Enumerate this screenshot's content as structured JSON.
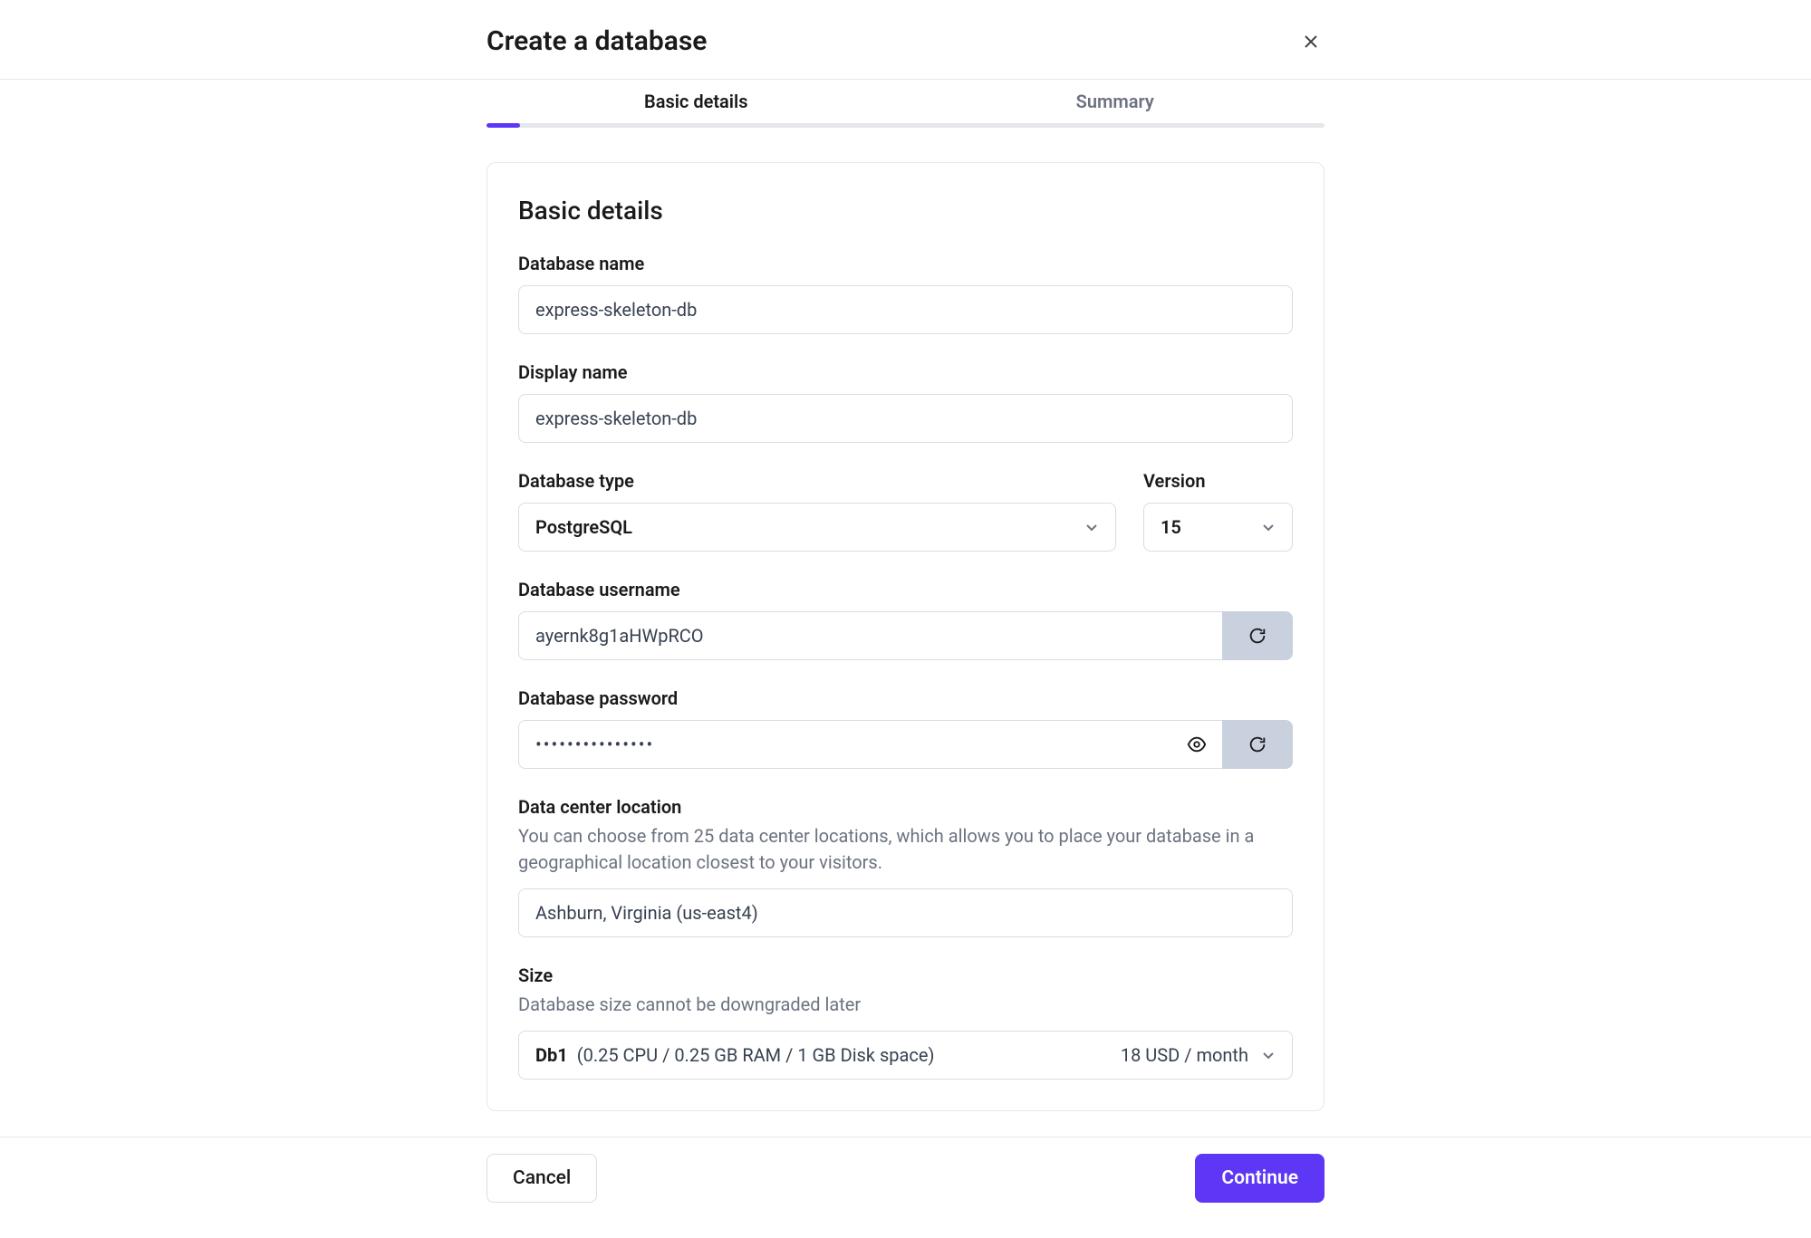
{
  "header": {
    "title": "Create a database"
  },
  "tabs": {
    "basic": "Basic details",
    "summary": "Summary"
  },
  "section": {
    "heading": "Basic details"
  },
  "fields": {
    "db_name": {
      "label": "Database name",
      "value": "express-skeleton-db"
    },
    "display_name": {
      "label": "Display name",
      "value": "express-skeleton-db"
    },
    "db_type": {
      "label": "Database type",
      "value": "PostgreSQL"
    },
    "version": {
      "label": "Version",
      "value": "15"
    },
    "username": {
      "label": "Database username",
      "value": "ayernk8g1aHWpRCO"
    },
    "password": {
      "label": "Database password",
      "value": "•••••••••••••••"
    },
    "location": {
      "label": "Data center location",
      "help": "You can choose from 25 data center locations, which allows you to place your database in a geographical location closest to your visitors.",
      "value": "Ashburn, Virginia (us-east4)"
    },
    "size": {
      "label": "Size",
      "help": "Database size cannot be downgraded later",
      "tier": "Db1",
      "spec": "(0.25 CPU / 0.25 GB RAM / 1 GB Disk space)",
      "price": "18 USD / month"
    }
  },
  "footer": {
    "cancel": "Cancel",
    "continue": "Continue"
  }
}
